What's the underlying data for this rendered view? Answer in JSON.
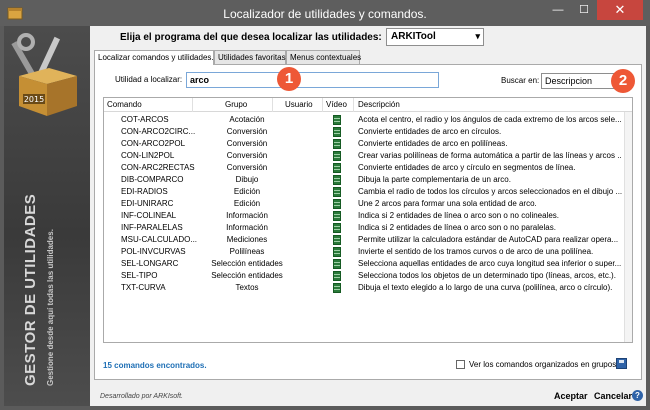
{
  "window": {
    "title": "Localizador de utilidades y comandos.",
    "minimize_glyph": "—",
    "maximize_glyph": "☐",
    "close_glyph": "✕"
  },
  "sidebar": {
    "logo_year": "2015",
    "title": "GESTOR DE UTILIDADES",
    "subtitle": "Gestione desde aquí todas las utilidades."
  },
  "program": {
    "prompt": "Elija el programa del que desea localizar las utilidades:",
    "selected": "ARKITool"
  },
  "tabs": [
    {
      "label": "Localizar comandos y utilidades.",
      "active": true
    },
    {
      "label": "Utilidades favoritas.",
      "active": false
    },
    {
      "label": "Menus contextuales",
      "active": false
    }
  ],
  "search": {
    "label": "Utilidad a localizar:",
    "value": "arco",
    "buscar_label": "Buscar en:",
    "buscar_value": "Descripcion"
  },
  "badges": [
    "1",
    "2"
  ],
  "table": {
    "columns": [
      "Comando",
      "Grupo",
      "Usuario",
      "Vídeo",
      "Descripción"
    ],
    "rows": [
      {
        "cmd": "COT-ARCOS",
        "grp": "Acotación",
        "desc": "Acota el centro, el radio y los ángulos de cada extremo de los arcos sele..."
      },
      {
        "cmd": "CON-ARCO2CIRC...",
        "grp": "Conversión",
        "desc": "Convierte entidades de arco en círculos."
      },
      {
        "cmd": "CON-ARCO2POL",
        "grp": "Conversión",
        "desc": "Convierte entidades de arco en polilíneas."
      },
      {
        "cmd": "CON-LIN2POL",
        "grp": "Conversión",
        "desc": "Crear varias polilíneas de forma automática a partir de las líneas y arcos ..."
      },
      {
        "cmd": "CON-ARC2RECTAS",
        "grp": "Conversión",
        "desc": "Convierte entidades de arco y círculo en segmentos de línea."
      },
      {
        "cmd": "DIB-COMPARCO",
        "grp": "Dibujo",
        "desc": "Dibuja la parte complementaria de un arco."
      },
      {
        "cmd": "EDI-RADIOS",
        "grp": "Edición",
        "desc": "Cambia el radio de todos los círculos y arcos seleccionados en el dibujo ..."
      },
      {
        "cmd": "EDI-UNIRARC",
        "grp": "Edición",
        "desc": "Une 2 arcos para formar una sola entidad de arco."
      },
      {
        "cmd": "INF-COLINEAL",
        "grp": "Información",
        "desc": "Indica si 2 entidades de línea o arco son o no colineales."
      },
      {
        "cmd": "INF-PARALELAS",
        "grp": "Información",
        "desc": "Indica si 2 entidades de línea o arco son o no paralelas."
      },
      {
        "cmd": "MSU-CALCULADO...",
        "grp": "Mediciones",
        "desc": "Permite utilizar la calculadora estándar de AutoCAD para realizar opera..."
      },
      {
        "cmd": "POL-INVCURVAS",
        "grp": "Polilíneas",
        "desc": "Invierte el sentido de los tramos curvos o de arco de una polilínea."
      },
      {
        "cmd": "SEL-LONGARC",
        "grp": "Selección entidades",
        "desc": "Selecciona aquellas entidades de arco cuya longitud sea inferior o super..."
      },
      {
        "cmd": "SEL-TIPO",
        "grp": "Selección entidades",
        "desc": "Selecciona todos los objetos de un determinado tipo (líneas, arcos, etc.)."
      },
      {
        "cmd": "TXT-CURVA",
        "grp": "Textos",
        "desc": "Dibuja el texto elegido a lo largo de una curva (polilínea, arco o círculo)."
      }
    ]
  },
  "footer": {
    "count": "15 comandos encontrados.",
    "checkbox_label": "Ver los comandos organizados en grupos",
    "developed_by": "Desarrollado por ARKIsoft.",
    "accept": "Aceptar",
    "cancel": "Cancelar",
    "help_glyph": "?"
  },
  "colors": {
    "badge": "#ee5836",
    "close_button": "#c7463e",
    "count_text": "#1e6fb5"
  }
}
